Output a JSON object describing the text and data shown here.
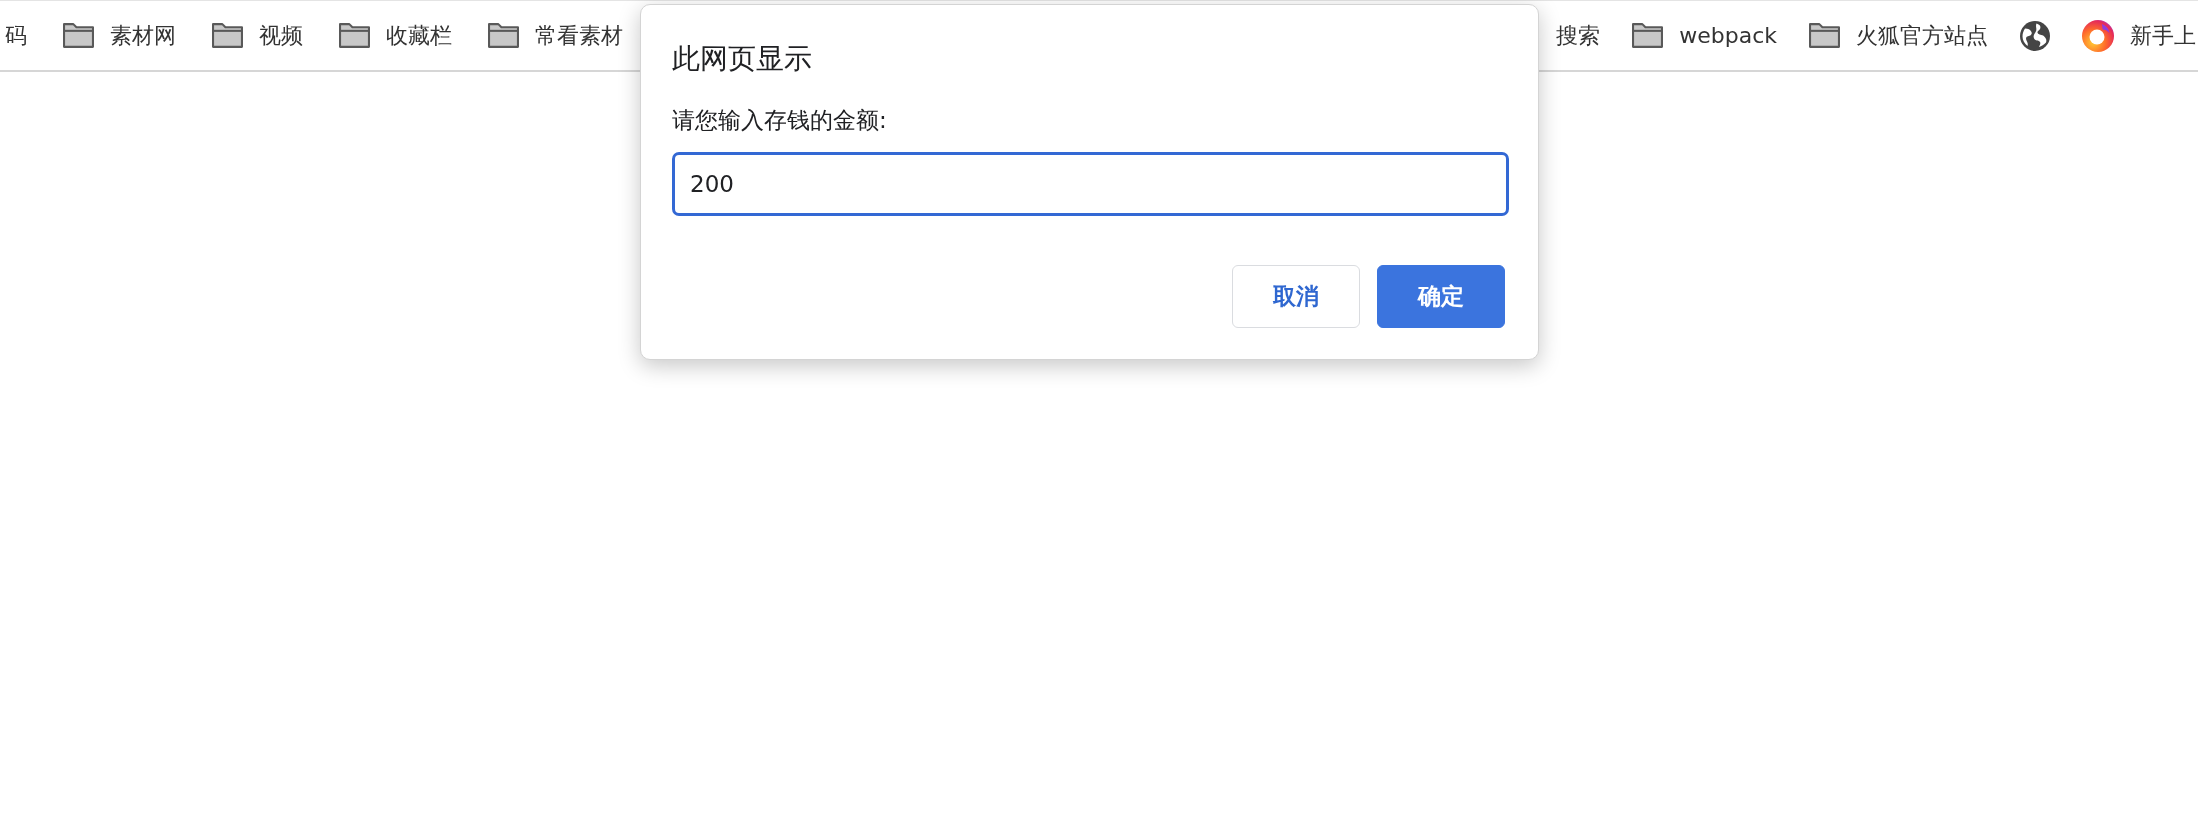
{
  "bookmarks_bar": {
    "left_items": [
      {
        "kind": "text",
        "label": "码"
      },
      {
        "kind": "folder",
        "label": "素材网"
      },
      {
        "kind": "folder",
        "label": "视频"
      },
      {
        "kind": "folder",
        "label": "收藏栏"
      },
      {
        "kind": "folder",
        "label": "常看素材"
      }
    ],
    "right_items": [
      {
        "kind": "text",
        "label": "搜索"
      },
      {
        "kind": "folder",
        "label": "webpack"
      },
      {
        "kind": "folder",
        "label": "火狐官方站点"
      },
      {
        "kind": "globe"
      },
      {
        "kind": "logo",
        "label": "新手上"
      }
    ]
  },
  "dialog": {
    "title": "此网页显示",
    "message": "请您输入存钱的金额:",
    "input": {
      "value": "200",
      "focused": true
    },
    "buttons": [
      {
        "label": "取消",
        "kind": "secondary"
      },
      {
        "label": "确定",
        "kind": "primary"
      }
    ]
  }
}
